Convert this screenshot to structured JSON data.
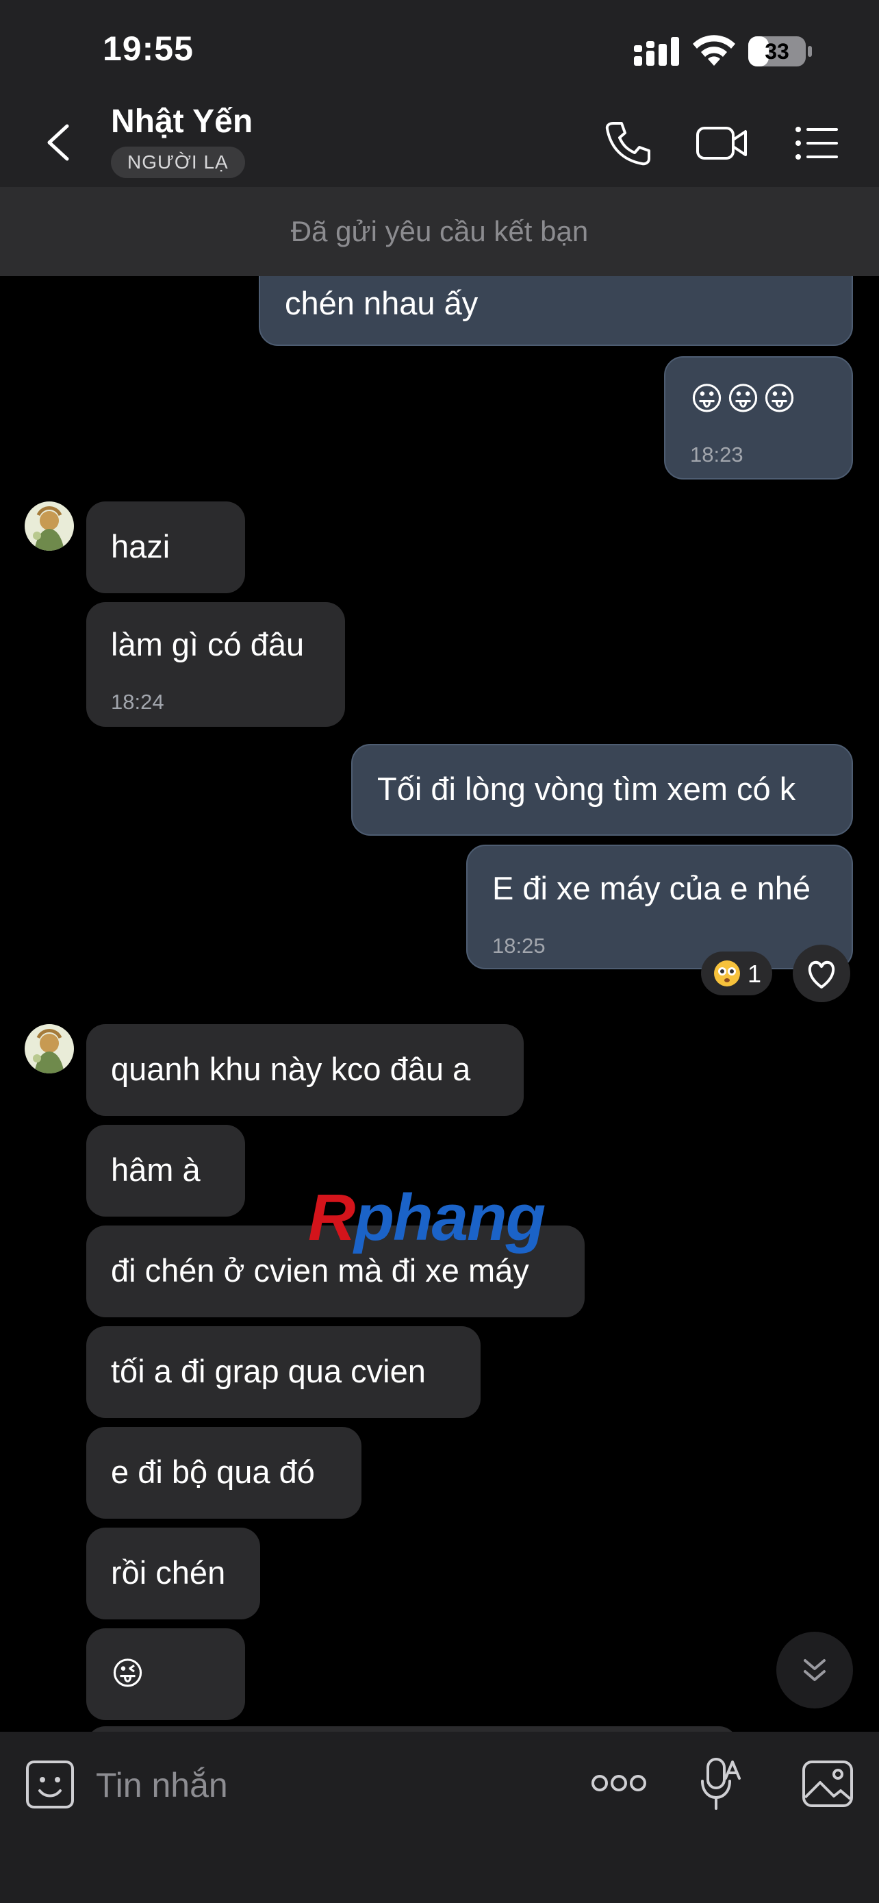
{
  "status_bar": {
    "time": "19:55",
    "battery": "33"
  },
  "header": {
    "contact_name": "Nhật Yến",
    "badge": "NGƯỜI LẠ"
  },
  "friend_request_notice": "Đã gửi yêu cầu kết bạn",
  "messages": [
    {
      "side": "out",
      "text": "chén nhau ấy"
    },
    {
      "side": "out",
      "text": "😛😛😛",
      "time": "18:23"
    },
    {
      "side": "in",
      "text": "hazi"
    },
    {
      "side": "in",
      "text": "làm gì có đâu",
      "time": "18:24"
    },
    {
      "side": "out",
      "text": "Tối đi lòng vòng tìm xem có k"
    },
    {
      "side": "out",
      "text": "E đi xe máy của e nhé",
      "time": "18:25"
    },
    {
      "side": "in",
      "text": "quanh khu này kco đâu a"
    },
    {
      "side": "in",
      "text": "hâm à"
    },
    {
      "side": "in",
      "text": "đi chén ở cvien mà đi xe máy"
    },
    {
      "side": "in",
      "text": "tối a đi grap qua cvien"
    },
    {
      "side": "in",
      "text": "e đi bộ qua đó"
    },
    {
      "side": "in",
      "text": "rồi chén"
    },
    {
      "side": "in",
      "text": "😜"
    }
  ],
  "reaction": {
    "emoji": "😳",
    "count": "1"
  },
  "watermark": {
    "first": "R",
    "rest": "phang"
  },
  "composer": {
    "placeholder": "Tin nhắn"
  },
  "colors": {
    "header_bg": "#222224",
    "incoming_bubble": "#2b2b2d",
    "outgoing_bubble": "#3a4555"
  }
}
